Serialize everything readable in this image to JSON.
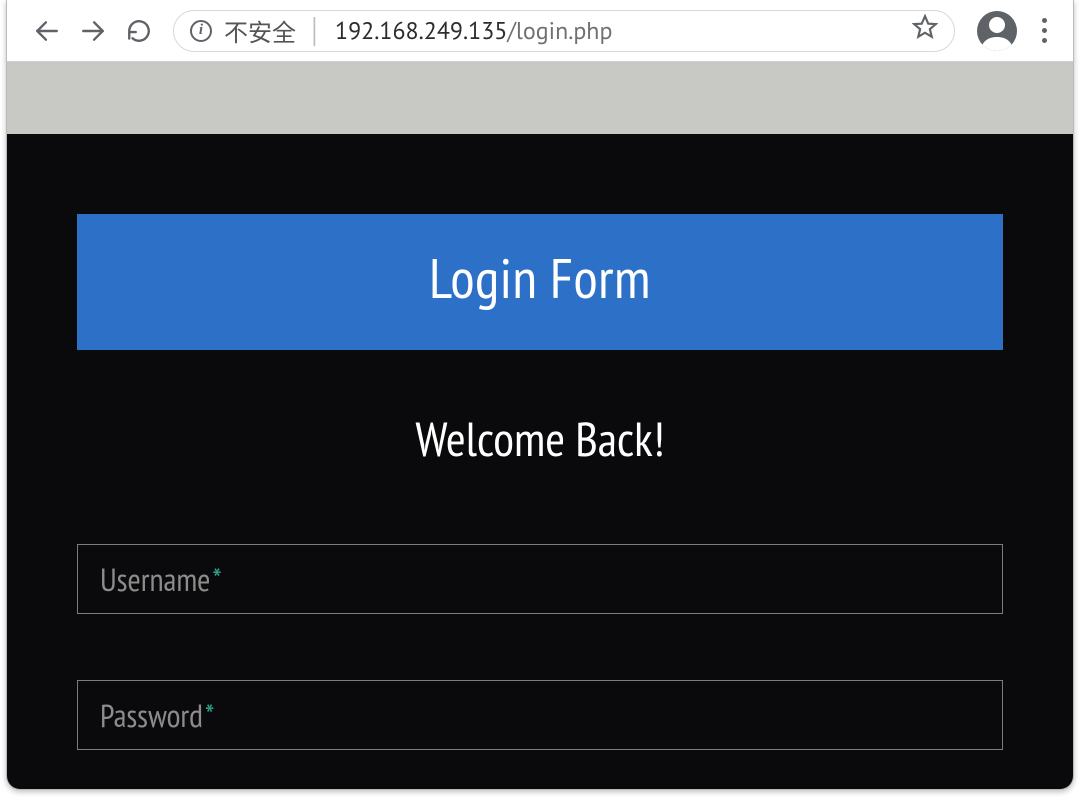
{
  "chrome": {
    "insecure_label": "不安全",
    "url_host": "192.168.249.135",
    "url_path": "/login.php"
  },
  "page": {
    "banner": "Login Form",
    "welcome": "Welcome Back!",
    "username_label": "Username",
    "password_label": "Password",
    "required_mark": "*"
  }
}
